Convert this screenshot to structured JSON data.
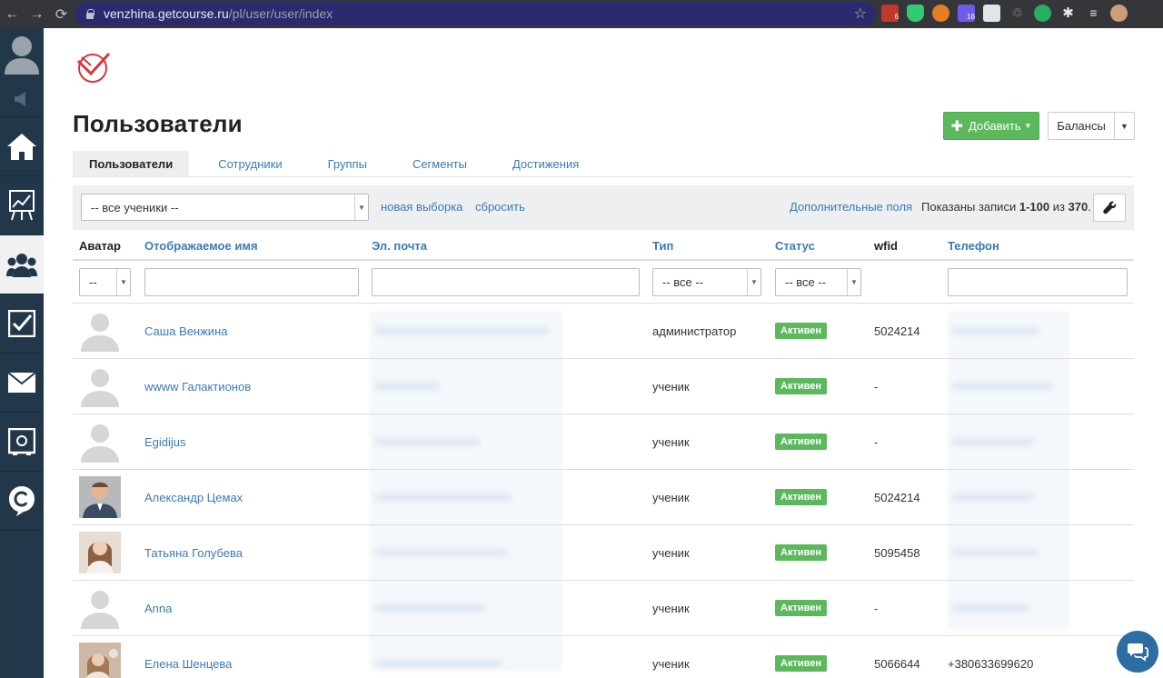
{
  "browser": {
    "url_host": "venzhina.getcourse.ru",
    "url_path": "/pl/user/user/index",
    "ext_badge_1": "6",
    "ext_badge_2": "16"
  },
  "page": {
    "title": "Пользователи",
    "add_button": "Добавить",
    "balances_button": "Балансы"
  },
  "tabs": [
    {
      "label": "Пользователи",
      "active": true
    },
    {
      "label": "Сотрудники"
    },
    {
      "label": "Группы"
    },
    {
      "label": "Сегменты"
    },
    {
      "label": "Достижения"
    }
  ],
  "filterbar": {
    "segment_value": "-- все ученики --",
    "new_selection": "новая выборка",
    "reset": "сбросить",
    "extra_fields": "Дополнительные поля",
    "records_prefix": "Показаны записи",
    "records_range": "1-100",
    "records_of": "из",
    "records_total": "370",
    "records_suffix": "."
  },
  "columns": {
    "avatar": "Аватар",
    "name": "Отображаемое имя",
    "email": "Эл. почта",
    "type": "Тип",
    "status": "Статус",
    "wfid": "wfid",
    "phone": "Телефон"
  },
  "filters": {
    "avatar_value": "--",
    "type_value": "-- все --",
    "status_value": "-- все --"
  },
  "rows": [
    {
      "name": "Саша Венжина",
      "type": "администратор",
      "status": "Активен",
      "wfid": "5024214",
      "phone": "",
      "avatar": "placeholder"
    },
    {
      "name": "wwww Галактионов",
      "type": "ученик",
      "status": "Активен",
      "wfid": "-",
      "phone": "",
      "avatar": "placeholder"
    },
    {
      "name": "Egidijus",
      "type": "ученик",
      "status": "Активен",
      "wfid": "-",
      "phone": "",
      "avatar": "placeholder"
    },
    {
      "name": "Александр Цемах",
      "type": "ученик",
      "status": "Активен",
      "wfid": "5024214",
      "phone": "",
      "avatar": "photo-man"
    },
    {
      "name": "Татьяна Голубева",
      "type": "ученик",
      "status": "Активен",
      "wfid": "5095458",
      "phone": "",
      "avatar": "photo-woman"
    },
    {
      "name": "Anna",
      "type": "ученик",
      "status": "Активен",
      "wfid": "-",
      "phone": "",
      "avatar": "placeholder"
    },
    {
      "name": "Елена Шенцева",
      "type": "ученик",
      "status": "Активен",
      "wfid": "5066644",
      "phone": "+380633699620",
      "avatar": "photo-woman2"
    }
  ],
  "colors": {
    "sidebar": "#23374b",
    "link": "#3a7bb5",
    "success": "#5cb85c",
    "urlbar": "#2b2a6e"
  }
}
